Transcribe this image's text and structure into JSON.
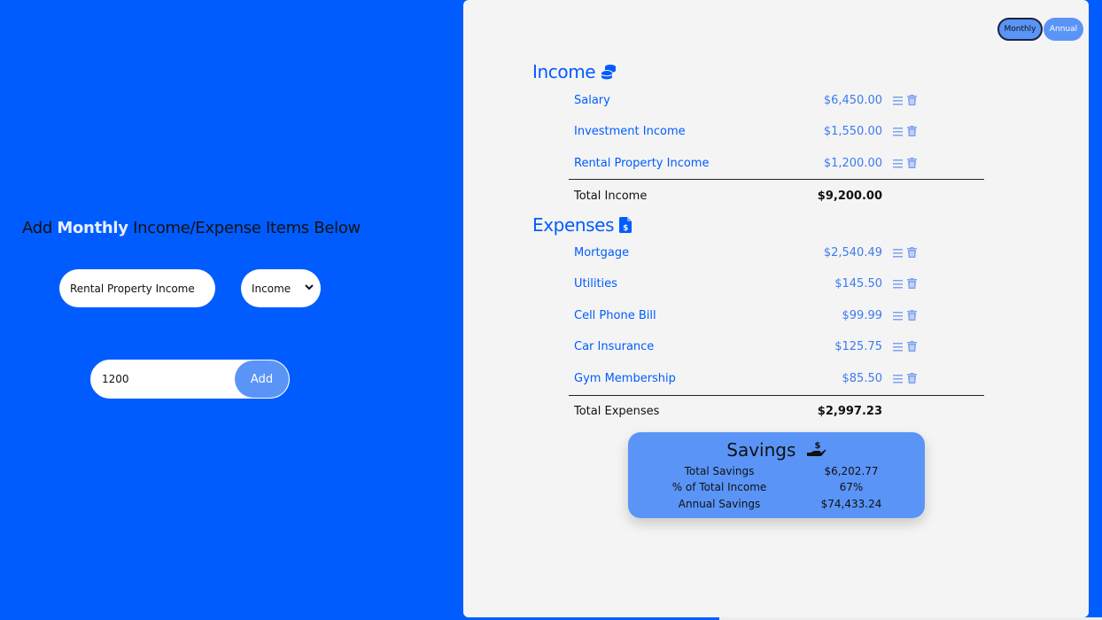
{
  "form": {
    "heading_prefix": "Add",
    "heading_highlight": "Monthly",
    "heading_suffix": "Income/Expense Items Below",
    "name_value": "Rental Property Income",
    "type_selected": "Income",
    "amount_value": "1200",
    "add_label": "Add"
  },
  "toggle": {
    "monthly_label": "Monthly",
    "annual_label": "Annual",
    "active": "Monthly"
  },
  "income": {
    "title": "Income",
    "icon": "coins-icon",
    "items": [
      {
        "name": "Salary",
        "amount": "$6,450.00"
      },
      {
        "name": "Investment Income",
        "amount": "$1,550.00"
      },
      {
        "name": "Rental Property Income",
        "amount": "$1,200.00"
      }
    ],
    "total_label": "Total Income",
    "total_value": "$9,200.00"
  },
  "expenses": {
    "title": "Expenses",
    "icon": "invoice-dollar-icon",
    "items": [
      {
        "name": "Mortgage",
        "amount": "$2,540.49"
      },
      {
        "name": "Utilities",
        "amount": "$145.50"
      },
      {
        "name": "Cell Phone Bill",
        "amount": "$99.99"
      },
      {
        "name": "Car Insurance",
        "amount": "$125.75"
      },
      {
        "name": "Gym Membership",
        "amount": "$85.50"
      }
    ],
    "total_label": "Total Expenses",
    "total_value": "$2,997.23"
  },
  "savings": {
    "title": "Savings",
    "icon": "hand-dollar-icon",
    "total_label": "Total Savings",
    "total_value": "$6,202.77",
    "pct_label": "% of Total Income",
    "pct_value": "67%",
    "annual_label": "Annual Savings",
    "annual_value": "$74,433.24"
  },
  "colors": {
    "brand_blue": "#005cff",
    "button_blue": "#5a94f7",
    "panel_bg": "#f4f4f4"
  }
}
